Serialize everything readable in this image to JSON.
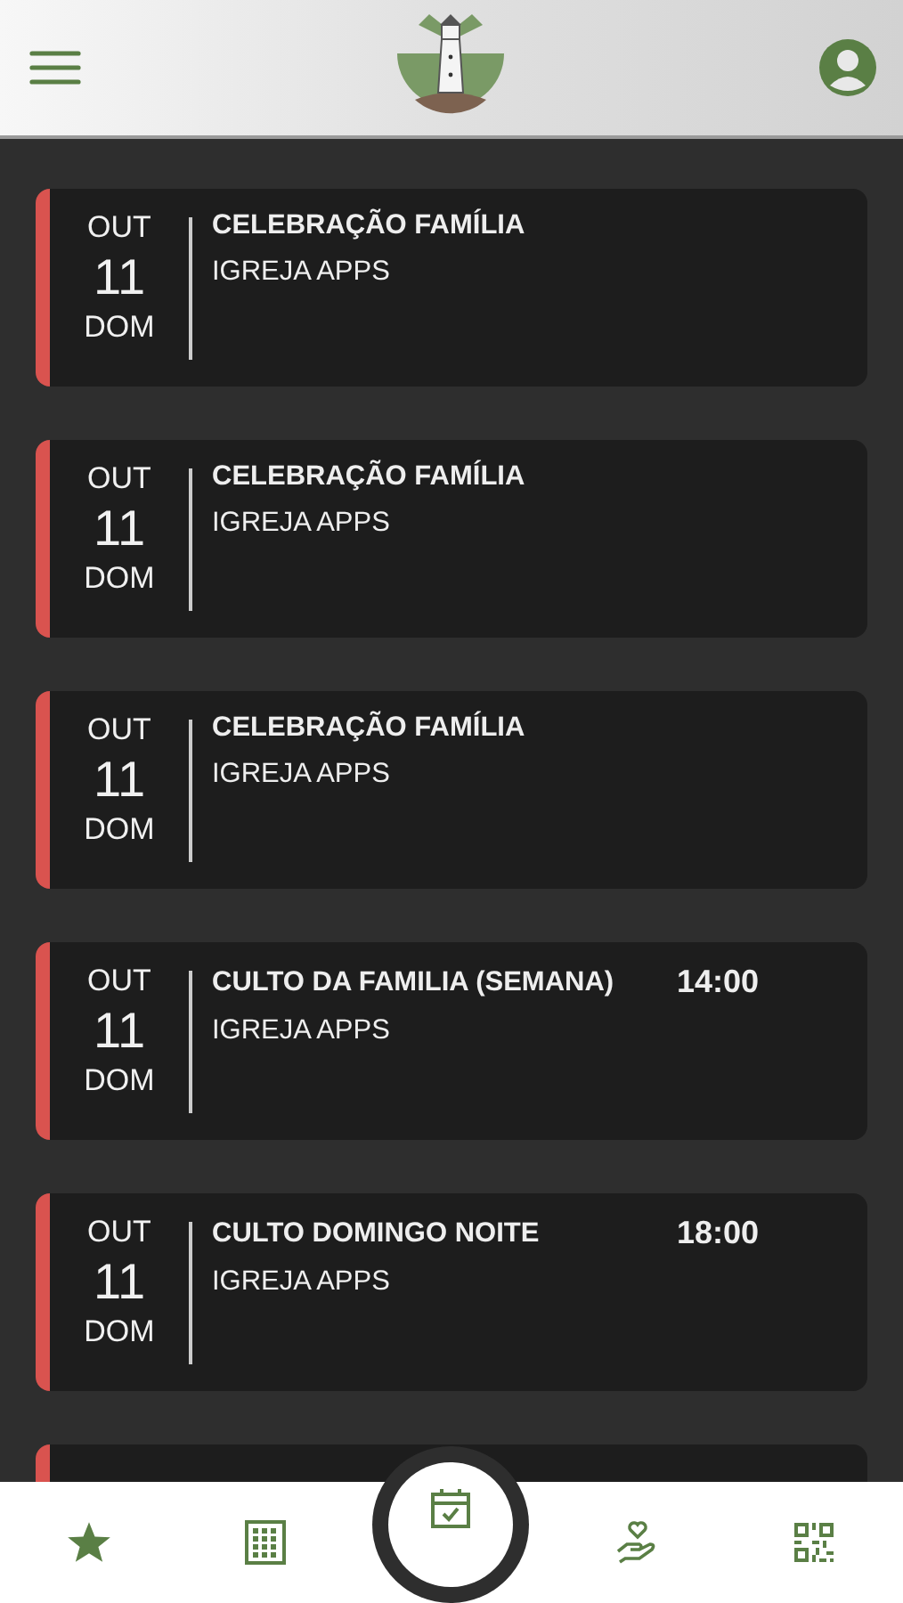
{
  "events": [
    {
      "month": "OUT",
      "day": "11",
      "weekday": "DOM",
      "title": "CELEBRAÇÃO FAMÍLIA",
      "subtitle": "IGREJA APPS"
    },
    {
      "month": "OUT",
      "day": "11",
      "weekday": "DOM",
      "title": "CELEBRAÇÃO FAMÍLIA",
      "subtitle": "IGREJA APPS"
    },
    {
      "month": "OUT",
      "day": "11",
      "weekday": "DOM",
      "title": "CELEBRAÇÃO FAMÍLIA",
      "subtitle": "IGREJA APPS"
    },
    {
      "month": "OUT",
      "day": "11",
      "weekday": "DOM",
      "title": "CULTO DA FAMILIA (SEMANA)",
      "subtitle": "IGREJA APPS",
      "time": "14:00"
    },
    {
      "month": "OUT",
      "day": "11",
      "weekday": "DOM",
      "title": "CULTO DOMINGO NOITE",
      "subtitle": "IGREJA APPS",
      "time": "18:00"
    }
  ],
  "bottom_nav": [
    {
      "kind": "star",
      "selected": false
    },
    {
      "kind": "building",
      "selected": false
    },
    {
      "kind": "calendar",
      "selected": true
    },
    {
      "kind": "charity",
      "selected": false
    },
    {
      "kind": "qr",
      "selected": false
    }
  ]
}
